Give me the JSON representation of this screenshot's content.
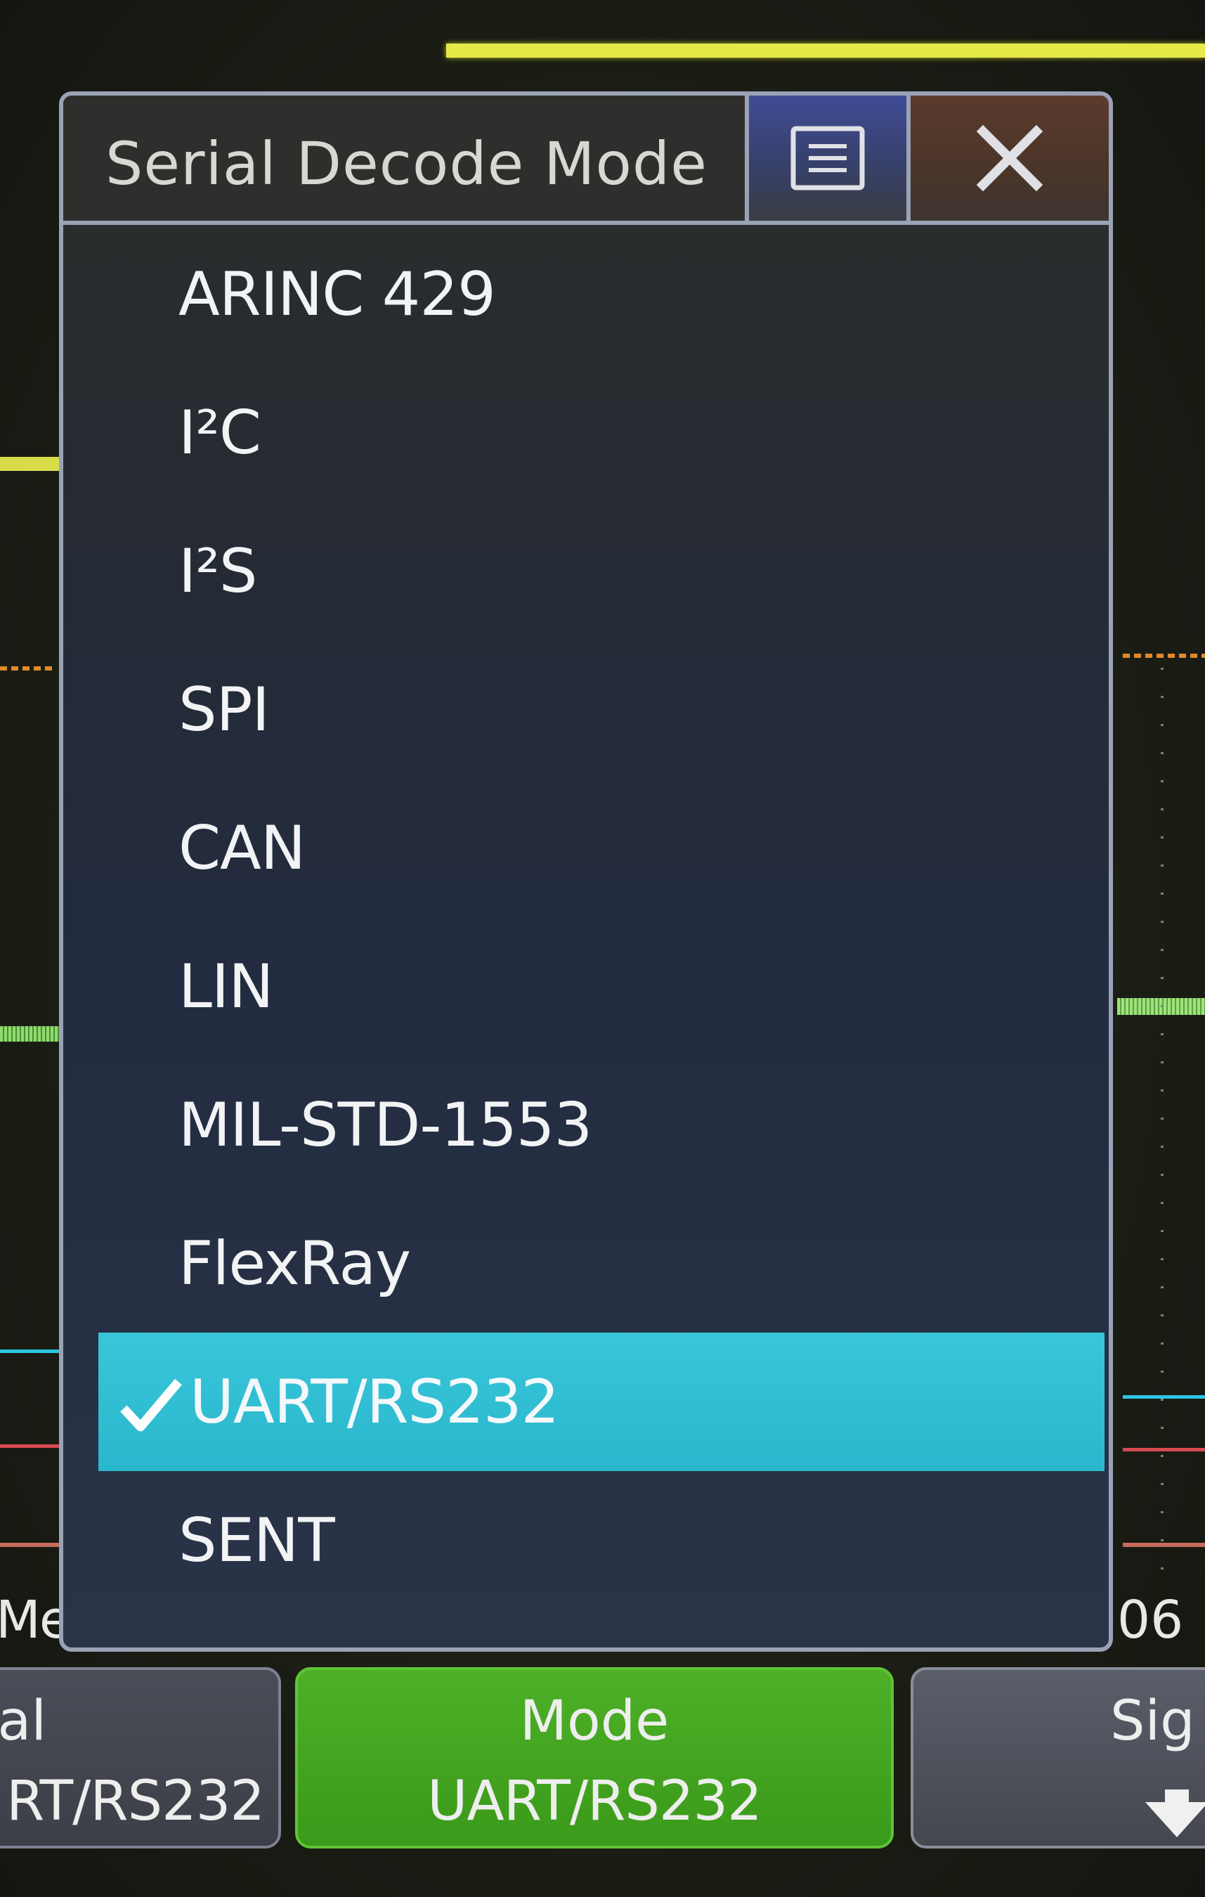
{
  "dialog": {
    "title": "Serial Decode Mode",
    "menu_icon": "menu-icon",
    "close_icon": "close-icon"
  },
  "modes": [
    {
      "label": "ARINC 429",
      "selected": false
    },
    {
      "label": "I²C",
      "selected": false
    },
    {
      "label": "I²S",
      "selected": false
    },
    {
      "label": "SPI",
      "selected": false
    },
    {
      "label": "CAN",
      "selected": false
    },
    {
      "label": "LIN",
      "selected": false
    },
    {
      "label": "MIL-STD-1553",
      "selected": false
    },
    {
      "label": "FlexRay",
      "selected": false
    },
    {
      "label": "UART/RS232",
      "selected": true
    },
    {
      "label": "SENT",
      "selected": false
    }
  ],
  "softkeys": {
    "serial": {
      "line1": "ial",
      "line2": "RT/RS232"
    },
    "mode": {
      "line1": "Mode",
      "line2": "UART/RS232"
    },
    "signal": {
      "line1": "Sig"
    }
  },
  "partial_labels": {
    "left": "Me",
    "right": "06"
  },
  "colors": {
    "selected_row": "#2ab7cd",
    "mode_softkey": "#3a9a1a",
    "menu_button": "#3f4c96",
    "close_button": "#5b3b2c"
  },
  "icons": {
    "check": "checkmark-icon",
    "signal_arrow": "down-arrow-icon"
  }
}
